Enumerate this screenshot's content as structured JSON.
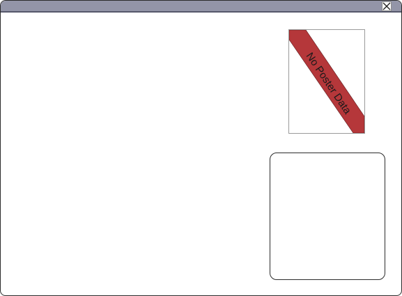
{
  "poster": {
    "placeholder_text": "No Poster Data",
    "ribbon_color": "#b5373a"
  },
  "titlebar": {
    "close_icon": "close-icon"
  },
  "info_panel": {
    "content": ""
  }
}
